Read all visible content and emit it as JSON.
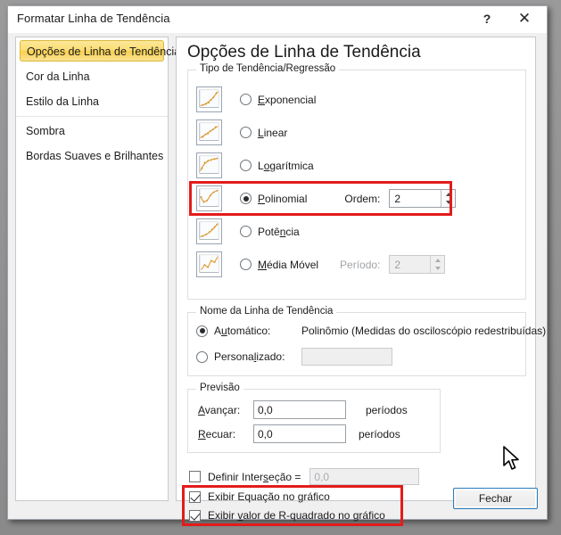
{
  "window": {
    "title": "Formatar Linha de Tendência",
    "help_label": "?",
    "close_label": "✕"
  },
  "sidebar": {
    "items": [
      {
        "label": "Opções de Linha de Tendência",
        "selected": true
      },
      {
        "label": "Cor da Linha",
        "selected": false
      },
      {
        "label": "Estilo da Linha",
        "selected": false
      },
      {
        "label": "Sombra",
        "selected": false
      },
      {
        "label": "Bordas Suaves e Brilhantes",
        "selected": false
      }
    ]
  },
  "panel": {
    "heading": "Opções de Linha de Tendência",
    "trend_type": {
      "group_label": "Tipo de Tendência/Regressão",
      "options": [
        {
          "label": "Exponencial",
          "selected": false
        },
        {
          "label": "Linear",
          "selected": false
        },
        {
          "label": "Logarítmica",
          "selected": false
        },
        {
          "label": "Polinomial",
          "selected": true
        },
        {
          "label": "Potência",
          "selected": false
        },
        {
          "label": "Média Móvel",
          "selected": false
        }
      ],
      "order_label": "Ordem:",
      "order_value": "2",
      "period_label": "Período:",
      "period_value": "2"
    },
    "trend_name": {
      "group_label": "Nome da Linha de Tendência",
      "automatic_label": "Automático:",
      "automatic_value": "Polinômio (Medidas do osciloscópio redestribuídas)",
      "automatic_selected": true,
      "custom_label": "Personalizado:",
      "custom_value": "",
      "custom_placeholder": ""
    },
    "forecast": {
      "group_label": "Previsão",
      "forward_label": "Avançar:",
      "forward_value": "0,0",
      "forward_unit": "períodos",
      "backward_label": "Recuar:",
      "backward_value": "0,0",
      "backward_unit": "períodos"
    },
    "intercept": {
      "label": "Definir Interseção  =",
      "value": "0,0",
      "checked": false
    },
    "display_options": [
      {
        "label": "Exibir Equação no gráfico",
        "checked": true
      },
      {
        "label": "Exibir valor de R-quadrado no gráfico",
        "checked": true
      }
    ]
  },
  "footer": {
    "close_button": "Fechar"
  },
  "colors": {
    "highlight_red": "#e41b1b",
    "selected_nav": "#fbdd72",
    "accent_blue": "#2d7fc1",
    "thumb_curve": "#e8a33d"
  }
}
